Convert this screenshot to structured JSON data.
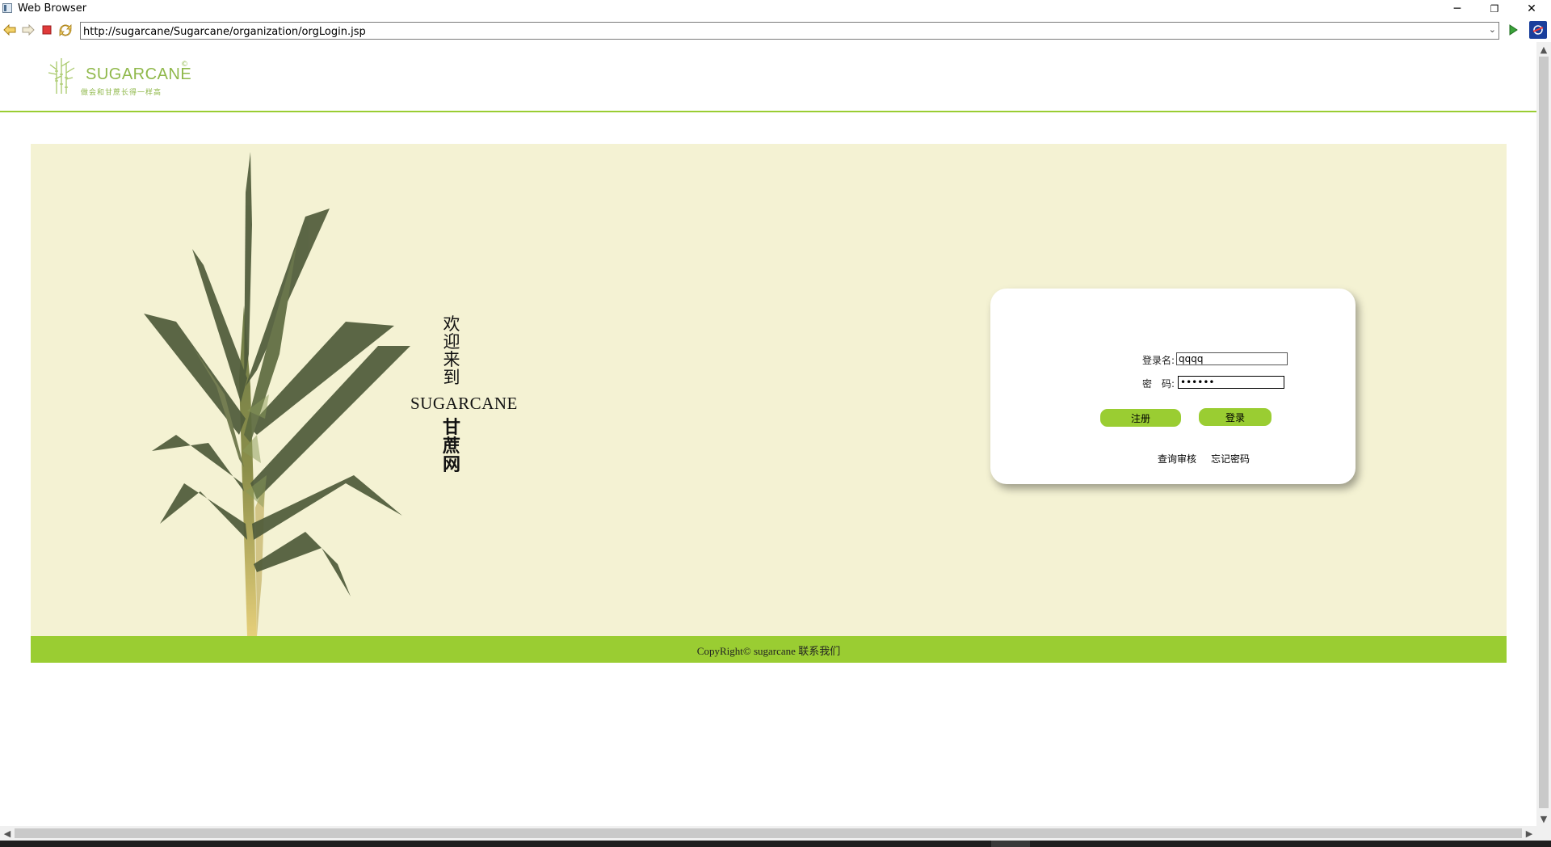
{
  "window": {
    "title": "Web Browser",
    "minimize_glyph": "─",
    "restore_glyph": "❐",
    "close_glyph": "✕"
  },
  "toolbar": {
    "back_icon": "back-arrow-icon",
    "forward_icon": "forward-arrow-icon",
    "stop_icon": "stop-icon",
    "refresh_icon": "refresh-icon",
    "go_icon": "go-icon",
    "url": "http://sugarcane/Sugarcane/organization/orgLogin.jsp"
  },
  "header": {
    "logo_text": "SUGARCANE",
    "logo_reg": "©",
    "logo_slogan": "做会和甘蔗长得一样高"
  },
  "banner": {
    "welcome_vertical": [
      "欢",
      "迎",
      "来",
      "到"
    ],
    "brand": "SUGARCANE",
    "site_name_vertical": [
      "甘",
      "蔗",
      "网"
    ]
  },
  "login": {
    "username_label": "登录名:",
    "username_value": "qqqq",
    "password_label": "密　码:",
    "password_value": "••••••",
    "register_button": "注册",
    "login_button": "登录",
    "query_review_link": "查询审核",
    "forgot_password_link": "忘记密码"
  },
  "footer": {
    "copyright": "CopyRight© sugarcane 联系我们"
  },
  "colors": {
    "accent_green": "#9acd32",
    "banner_bg": "#f4f2d3"
  }
}
